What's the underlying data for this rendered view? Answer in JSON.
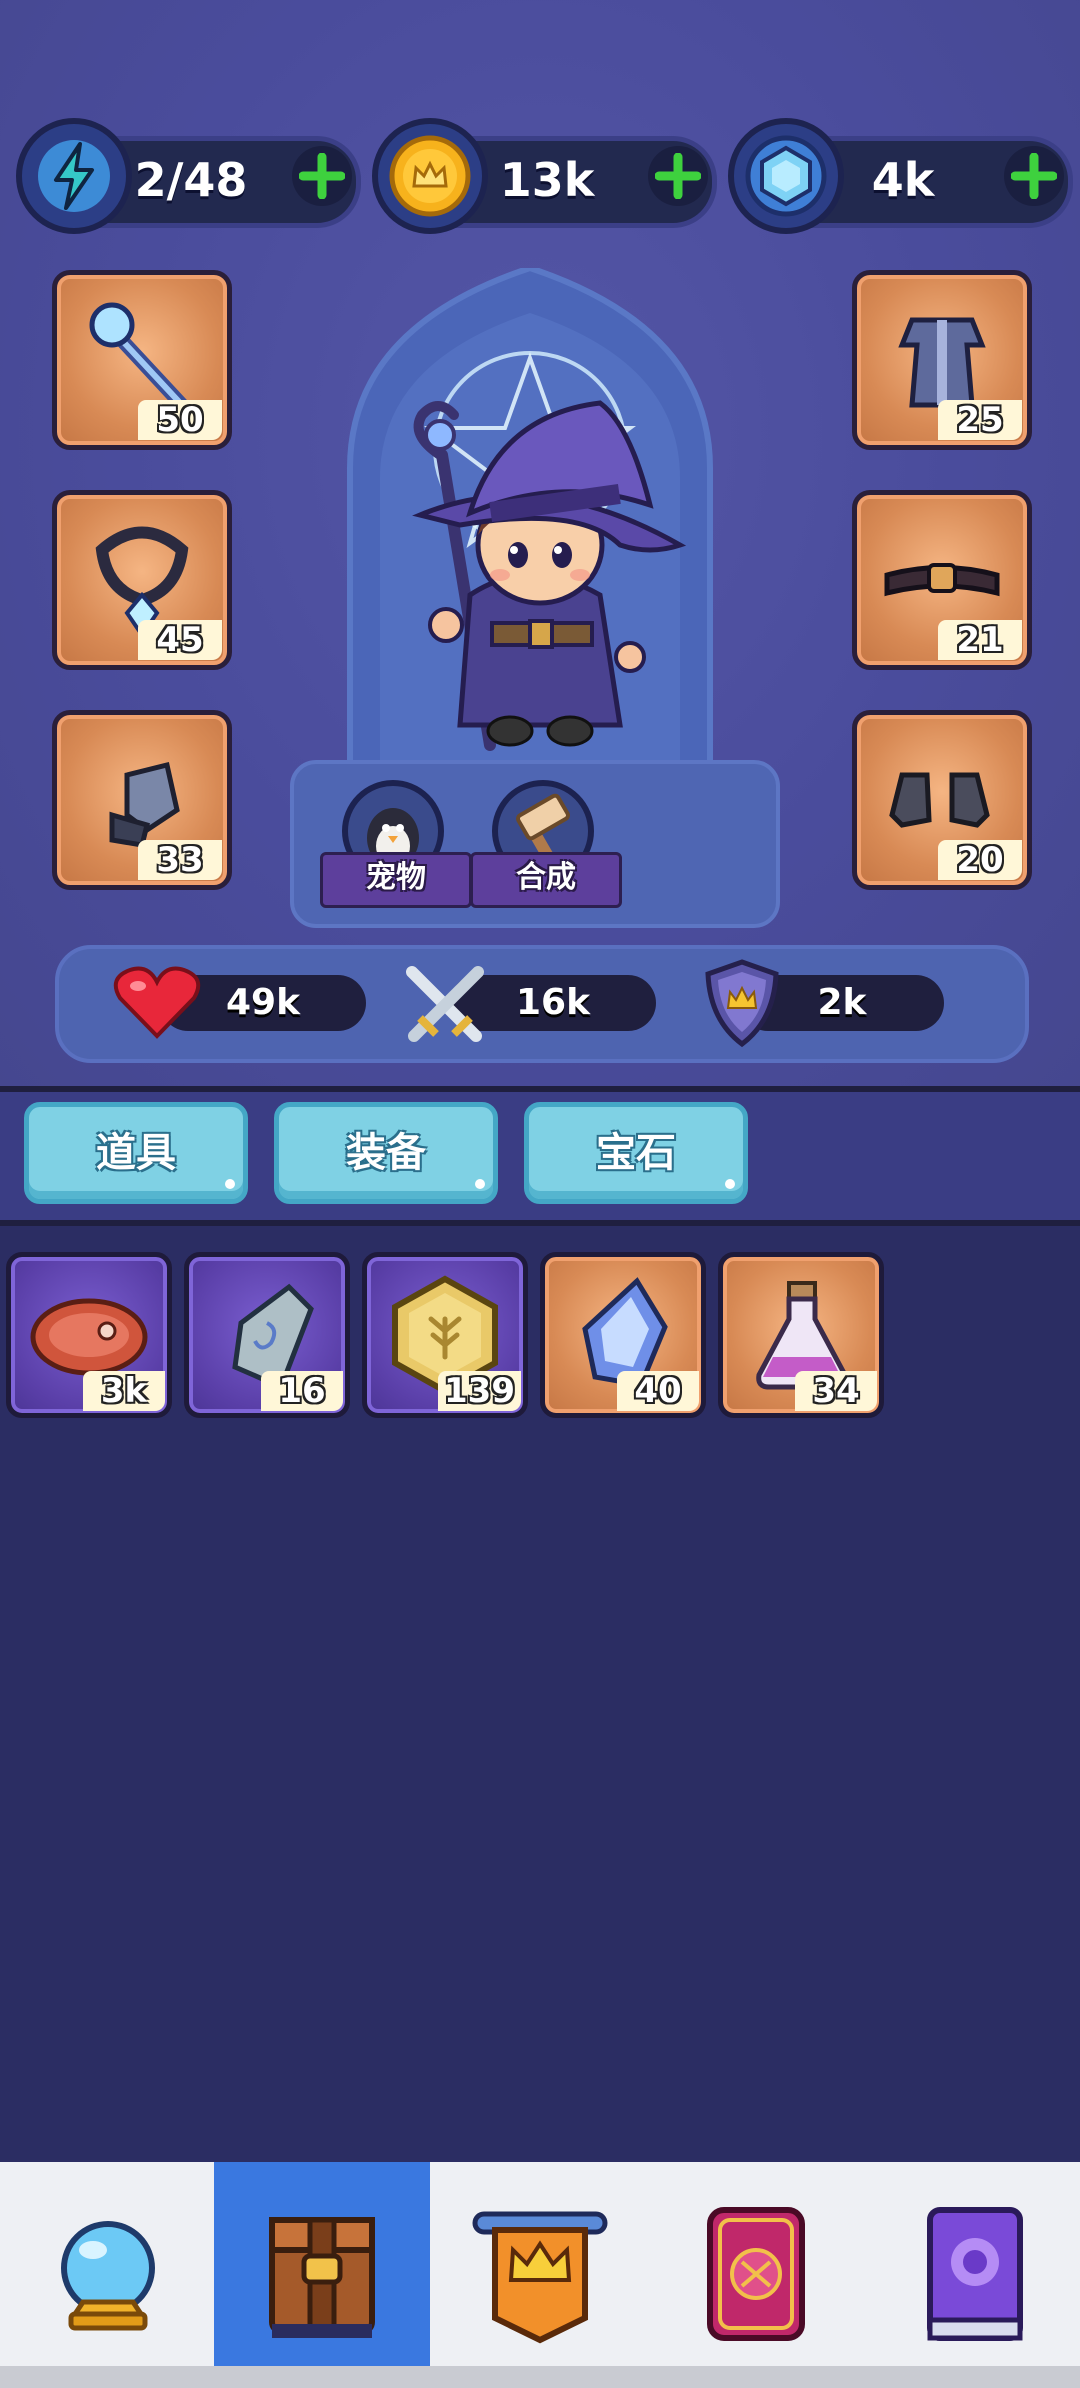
{
  "currencies": {
    "energy": {
      "value": "2/48",
      "icon": "lightning-icon"
    },
    "gold": {
      "value": "13k",
      "icon": "gold-coin-icon"
    },
    "gems": {
      "value": "4k",
      "icon": "blue-gem-icon"
    }
  },
  "equipment": {
    "left": [
      {
        "name": "staff",
        "count": "50",
        "icon": "magic-staff-icon"
      },
      {
        "name": "necklace",
        "count": "45",
        "icon": "necklace-icon"
      },
      {
        "name": "gloves",
        "count": "33",
        "icon": "gauntlet-icon"
      }
    ],
    "right": [
      {
        "name": "robe",
        "count": "25",
        "icon": "robe-icon"
      },
      {
        "name": "belt",
        "count": "21",
        "icon": "belt-icon"
      },
      {
        "name": "boots",
        "count": "20",
        "icon": "boots-icon"
      }
    ]
  },
  "actions": {
    "pet_label": "宠物",
    "craft_label": "合成"
  },
  "stats": {
    "hp": "49k",
    "attack": "16k",
    "defense": "2k"
  },
  "tabs": [
    {
      "label": "道具"
    },
    {
      "label": "装备"
    },
    {
      "label": "宝石"
    }
  ],
  "inventory": [
    {
      "name": "meat",
      "count": "3k",
      "rarity": "purple",
      "icon": "meat-icon"
    },
    {
      "name": "stone",
      "count": "16",
      "rarity": "purple",
      "icon": "rune-stone-icon"
    },
    {
      "name": "hex-token",
      "count": "139",
      "rarity": "purple",
      "icon": "hex-token-icon"
    },
    {
      "name": "crystal",
      "count": "40",
      "rarity": "orange",
      "icon": "crystal-icon"
    },
    {
      "name": "potion",
      "count": "34",
      "rarity": "orange",
      "icon": "potion-icon"
    }
  ],
  "nav": [
    {
      "name": "crystal-ball",
      "icon": "crystal-ball-icon",
      "active": false
    },
    {
      "name": "inventory",
      "icon": "backpack-icon",
      "active": true
    },
    {
      "name": "ranking",
      "icon": "crown-banner-icon",
      "active": false
    },
    {
      "name": "cards",
      "icon": "card-icon",
      "active": false
    },
    {
      "name": "book",
      "icon": "spellbook-icon",
      "active": false
    }
  ],
  "colors": {
    "accent": "#3a78e0",
    "tab": "#7fd1e4",
    "panel": "#4e64b0",
    "background": "#2b2d63"
  }
}
